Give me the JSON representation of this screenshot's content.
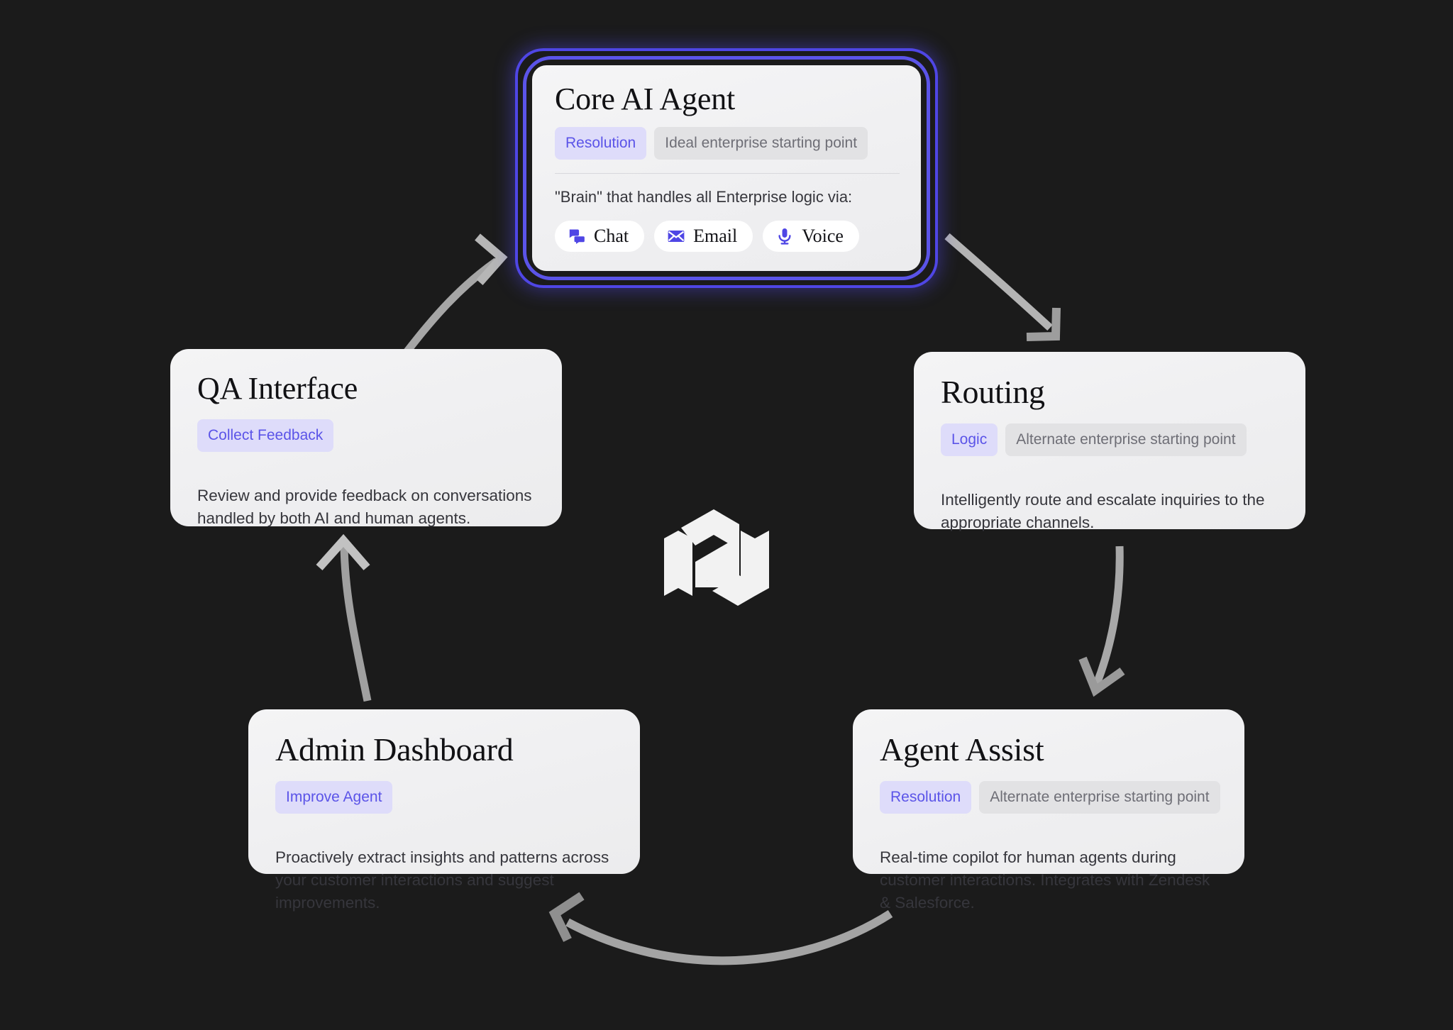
{
  "theme": {
    "background": "#1b1b1b",
    "card_background": "#f1f1f3",
    "accent": "#5b54e8",
    "glow": "#4f46e5",
    "badge_primary_bg": "#dedcfa",
    "badge_secondary_bg": "#e2e2e4",
    "arrow_color": "#a6a6a6"
  },
  "logo": {
    "name": "hexagon-logo-mark"
  },
  "cards": {
    "core": {
      "title": "Core AI Agent",
      "badge_primary": "Resolution",
      "badge_secondary": "Ideal enterprise starting point",
      "description": "\"Brain\" that handles all Enterprise logic via:",
      "channels": [
        {
          "label": "Chat",
          "icon": "chat-icon"
        },
        {
          "label": "Email",
          "icon": "email-icon"
        },
        {
          "label": "Voice",
          "icon": "microphone-icon"
        }
      ]
    },
    "routing": {
      "title": "Routing",
      "badge_primary": "Logic",
      "badge_secondary": "Alternate enterprise starting point",
      "description": "Intelligently route and escalate inquiries to the appropriate channels."
    },
    "agent_assist": {
      "title": "Agent Assist",
      "badge_primary": "Resolution",
      "badge_secondary": "Alternate enterprise starting point",
      "description": "Real-time copilot for human agents during customer interactions. Integrates with Zendesk & Salesforce."
    },
    "admin_dashboard": {
      "title": "Admin Dashboard",
      "badge_primary": "Improve Agent",
      "description": "Proactively extract insights and patterns across your customer interactions and suggest improvements."
    },
    "qa_interface": {
      "title": "QA Interface",
      "badge_primary": "Collect Feedback",
      "description": "Review and provide feedback on conversations handled by both AI and human agents."
    }
  },
  "flow": [
    {
      "from": "core",
      "to": "routing"
    },
    {
      "from": "routing",
      "to": "agent_assist"
    },
    {
      "from": "agent_assist",
      "to": "admin_dashboard"
    },
    {
      "from": "admin_dashboard",
      "to": "qa_interface"
    },
    {
      "from": "qa_interface",
      "to": "core"
    }
  ]
}
